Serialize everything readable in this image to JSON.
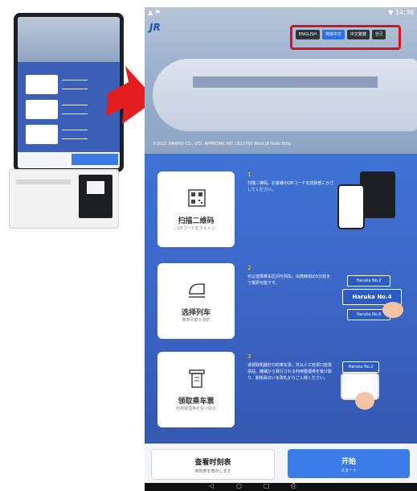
{
  "status_bar": {
    "left": "▲ ⚑",
    "right": "▼ 14:38"
  },
  "header": {
    "logo": "JR",
    "languages": [
      {
        "label": "ENGLISH",
        "active": false
      },
      {
        "label": "简体中文",
        "active": true
      },
      {
        "label": "中文繁體",
        "active": false
      },
      {
        "label": "한국",
        "active": false
      }
    ]
  },
  "hero": {
    "copyright": "©2021 SANRIO CO., LTD. APPROVAL NO. L621763 West JR Hello Kitty"
  },
  "steps": [
    {
      "number": "1",
      "title": "扫描二维码",
      "subtitle": "QRコードをスキャン",
      "desc": "扫描二维码。お客様のQRコードを読取部にかざしてください。",
      "icon": "qr-code-icon"
    },
    {
      "number": "2",
      "title": "选择列车",
      "subtitle": "乗車列車を選択",
      "desc": "可以选择乘车区间与列车。出発時刻の5分前まで選択可能です。",
      "icon": "train-icon",
      "tickets": [
        "Haruka No.2",
        "Haruka No.4",
        "Haruka No.6"
      ]
    },
    {
      "number": "3",
      "title": "领取乘车票",
      "subtitle": "利用整理券を受け取る",
      "desc": "请领取机器打印的乘车票，并从人工检票口检票进站。機械から発行される利用整理券を受け取り、駅係員のいる改札からご入場ください。",
      "icon": "ticket-icon",
      "ticket": "Haruka No.2"
    }
  ],
  "bottom": {
    "timetable": {
      "label": "查看时刻表",
      "sub": "時刻表を表示します"
    },
    "start": {
      "label": "开始",
      "sub": "スタート"
    }
  },
  "nav": {
    "icons": [
      "back-icon",
      "home-icon",
      "recents-icon",
      "screenshot-icon"
    ]
  },
  "colors": {
    "accent": "#3b7be8",
    "highlight": "#e01018",
    "step_number": "#f7d23b"
  }
}
